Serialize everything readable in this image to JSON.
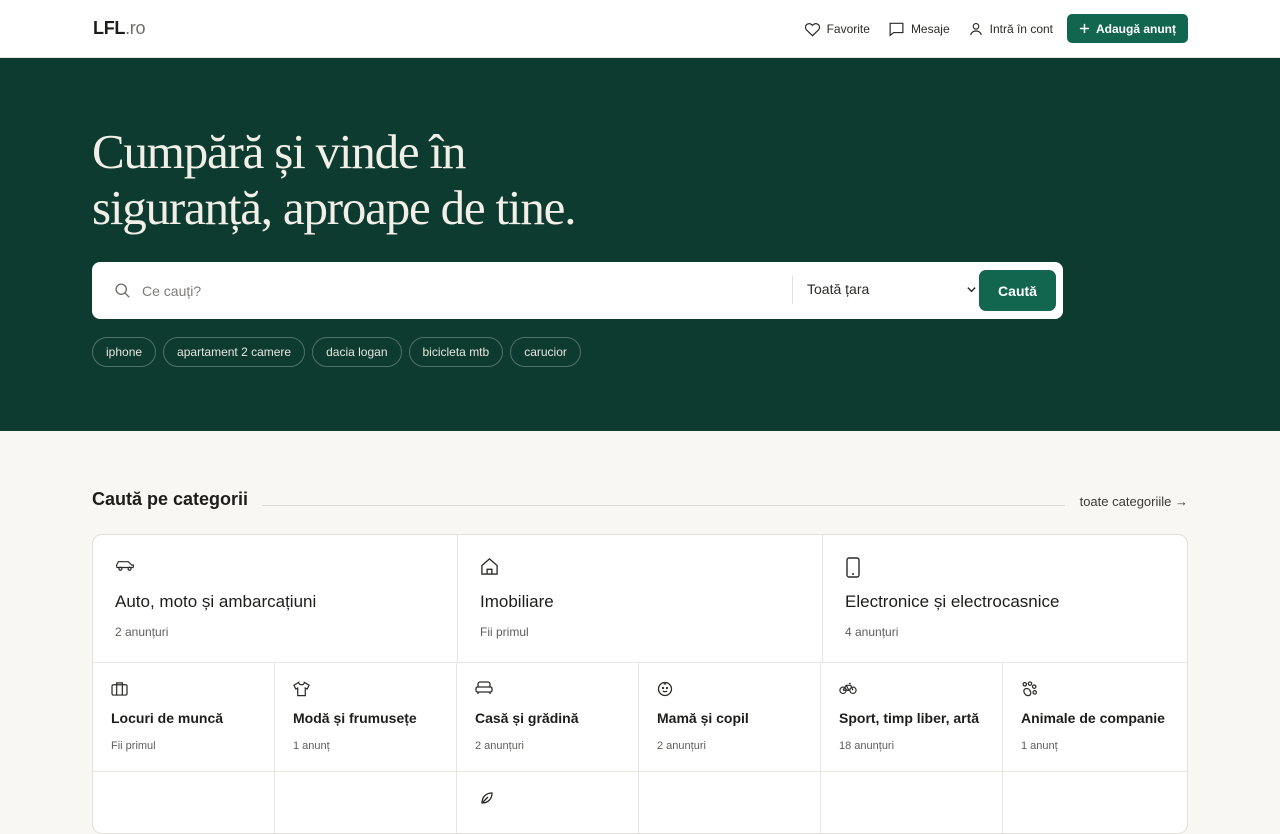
{
  "header": {
    "logo_main": "LFL",
    "logo_tld": ".ro",
    "favorites": "Favorite",
    "messages": "Mesaje",
    "login": "Intră în cont",
    "add_listing": "Adaugă anunț"
  },
  "hero": {
    "title_line1": "Cumpără și vinde în",
    "title_line2": "siguranță, aproape de tine.",
    "search_placeholder": "Ce cauți?",
    "region": "Toată țara",
    "search_button": "Caută",
    "chips": [
      "iphone",
      "apartament 2 camere",
      "dacia logan",
      "bicicleta mtb",
      "carucior"
    ]
  },
  "categories": {
    "title": "Caută pe categorii",
    "all_link": "toate categoriile →",
    "featured": [
      {
        "name": "Auto, moto și ambarcațiuni",
        "count": "2 anunțuri",
        "icon": "car-icon"
      },
      {
        "name": "Imobiliare",
        "count": "Fii primul",
        "icon": "home-icon"
      },
      {
        "name": "Electronice și electrocasnice",
        "count": "4 anunțuri",
        "icon": "phone-icon"
      }
    ],
    "items": [
      {
        "name": "Locuri de muncă",
        "count": "Fii primul",
        "icon": "briefcase-icon"
      },
      {
        "name": "Modă și frumusețe",
        "count": "1 anunț",
        "icon": "shirt-icon"
      },
      {
        "name": "Casă și grădină",
        "count": "2 anunțuri",
        "icon": "sofa-icon"
      },
      {
        "name": "Mamă și copil",
        "count": "2 anunțuri",
        "icon": "baby-icon"
      },
      {
        "name": "Sport, timp liber, artă",
        "count": "18 anunțuri",
        "icon": "bicycle-icon"
      },
      {
        "name": "Animale de companie",
        "count": "1 anunț",
        "icon": "paw-icon"
      }
    ]
  }
}
